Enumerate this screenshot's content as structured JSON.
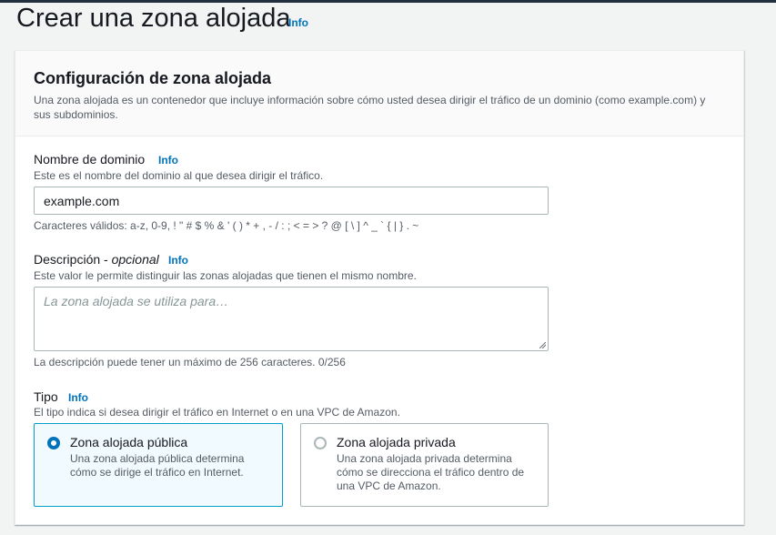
{
  "page": {
    "title": "Crear una zona alojada",
    "info_link": "Info"
  },
  "panel": {
    "title": "Configuración de zona alojada",
    "description": "Una zona alojada es un contenedor que incluye información sobre cómo usted desea dirigir el tráfico de un dominio (como example.com) y sus subdominios."
  },
  "domain": {
    "label": "Nombre de dominio",
    "info_link": "Info",
    "help": "Este es el nombre del dominio al que desea dirigir el tráfico.",
    "value": "example.com",
    "constraint": "Caracteres válidos: a-z, 0-9, ! \" # $ % & ' ( ) * + , - / : ; < = > ? @ [ \\ ] ^ _ ` { | } . ~"
  },
  "description_field": {
    "label": "Descripción - ",
    "label_optional": "opcional",
    "info_link": "Info",
    "help": "Este valor le permite distinguir las zonas alojadas que tienen el mismo nombre.",
    "placeholder": "La zona alojada se utiliza para…",
    "value": "",
    "constraint": "La descripción puede tener un máximo de 256 caracteres. 0/256"
  },
  "type": {
    "label": "Tipo",
    "info_link": "Info",
    "help": "El tipo indica si desea dirigir el tráfico en Internet o en una VPC de Amazon.",
    "options": [
      {
        "title": "Zona alojada pública",
        "description": "Una zona alojada pública determina cómo se dirige el tráfico en Internet.",
        "selected": true
      },
      {
        "title": "Zona alojada privada",
        "description": "Una zona alojada privada determina cómo se direcciona el tráfico dentro de una VPC de Amazon.",
        "selected": false
      }
    ]
  },
  "colors": {
    "link": "#0073bb",
    "selected_border": "#00a1c9",
    "selected_bg": "#f1faff"
  }
}
